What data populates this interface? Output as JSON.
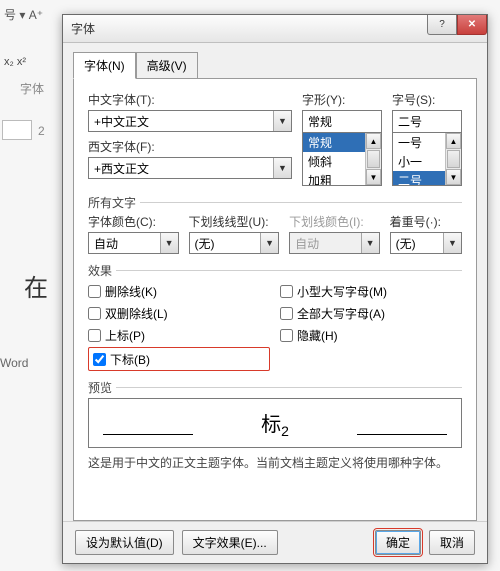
{
  "bg": {
    "ribbon": "号 ▾  A⁺",
    "x2": "x₂  x²",
    "font_group": "字体",
    "thumb_num": "2",
    "zai": "在",
    "word": "Word"
  },
  "dialog": {
    "title": "字体",
    "help_glyph": "?",
    "close_glyph": "✕",
    "tabs": {
      "font": "字体(N)",
      "advanced": "高级(V)"
    },
    "cn_font_label": "中文字体(T):",
    "cn_font_value": "+中文正文",
    "en_font_label": "西文字体(F):",
    "en_font_value": "+西文正文",
    "style_label": "字形(Y):",
    "style_value": "常规",
    "style_options": [
      "常规",
      "倾斜",
      "加粗"
    ],
    "size_label": "字号(S):",
    "size_value": "二号",
    "size_options": [
      "一号",
      "小一",
      "二号"
    ],
    "all_text": "所有文字",
    "font_color_label": "字体颜色(C):",
    "font_color_value": "自动",
    "ul_style_label": "下划线线型(U):",
    "ul_style_value": "(无)",
    "ul_color_label": "下划线颜色(I):",
    "ul_color_value": "自动",
    "emph_label": "着重号(·):",
    "emph_value": "(无)",
    "effects": "效果",
    "cb": {
      "strike": "删除线(K)",
      "dstrike": "双删除线(L)",
      "super": "上标(P)",
      "sub": "下标(B)",
      "smallcaps": "小型大写字母(M)",
      "allcaps": "全部大写字母(A)",
      "hidden": "隐藏(H)"
    },
    "preview_label": "预览",
    "preview_text": "标",
    "preview_sub": "2",
    "desc": "这是用于中文的正文主题字体。当前文档主题定义将使用哪种字体。",
    "footer": {
      "default": "设为默认值(D)",
      "texteff": "文字效果(E)...",
      "ok": "确定",
      "cancel": "取消"
    }
  }
}
